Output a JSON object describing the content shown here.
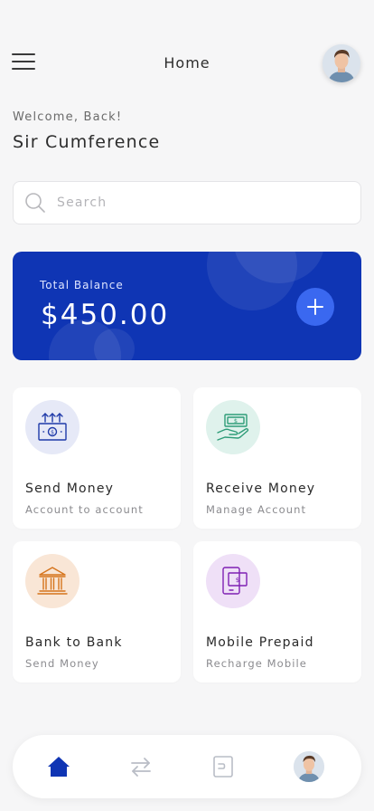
{
  "header": {
    "title": "Home",
    "menu_icon": "hamburger-menu-icon",
    "avatar_icon": "user-avatar"
  },
  "greeting": {
    "welcome": "Welcome, Back!",
    "name": "Sir Cumference"
  },
  "search": {
    "placeholder": "Search",
    "value": "",
    "icon": "search-icon"
  },
  "balance": {
    "label": "Total Balance",
    "amount": "$450.00",
    "add_icon": "plus-icon"
  },
  "actions": [
    {
      "title": "Send Money",
      "subtitle": "Account to account",
      "icon": "send-money-icon",
      "icon_bg": "#e6e9f7",
      "icon_color": "#1f3aa8"
    },
    {
      "title": "Receive Money",
      "subtitle": "Manage Account",
      "icon": "receive-money-icon",
      "icon_bg": "#dff2ec",
      "icon_color": "#2e9c78"
    },
    {
      "title": "Bank to Bank",
      "subtitle": "Send Money",
      "icon": "bank-icon",
      "icon_bg": "#f9e6d6",
      "icon_color": "#d6741c"
    },
    {
      "title": "Mobile Prepaid",
      "subtitle": "Recharge Mobile",
      "icon": "mobile-prepaid-icon",
      "icon_bg": "#efe0f7",
      "icon_color": "#7f20b4"
    }
  ],
  "bottom_nav": {
    "items": [
      "home-icon",
      "transfer-icon",
      "wallet-icon",
      "profile-avatar"
    ],
    "active": "home-icon"
  },
  "colors": {
    "primary": "#0f35b4",
    "accent": "#3a68f0",
    "background": "#f6f6f7"
  }
}
